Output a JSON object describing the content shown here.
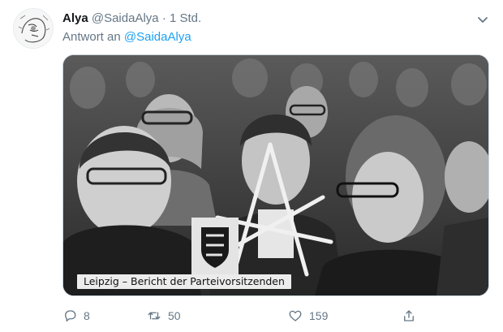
{
  "tweet": {
    "author_name": "Alya",
    "author_handle": "@SaidaAlya",
    "separator": "·",
    "time": "1 Std.",
    "reply_prefix": "Antwort an",
    "reply_to": "@SaidaAlya",
    "media": {
      "caption": "Leipzig – Bericht der Parteivorsitzenden"
    },
    "actions": {
      "replies": "8",
      "retweets": "50",
      "likes": "159"
    }
  },
  "icons": {
    "avatar": "avatar-image",
    "menu": "chevron-down-icon",
    "reply": "reply-icon",
    "retweet": "retweet-icon",
    "like": "heart-icon",
    "share": "share-icon"
  },
  "colors": {
    "name": "#14171a",
    "secondary": "#657786",
    "link": "#1da1f2"
  }
}
